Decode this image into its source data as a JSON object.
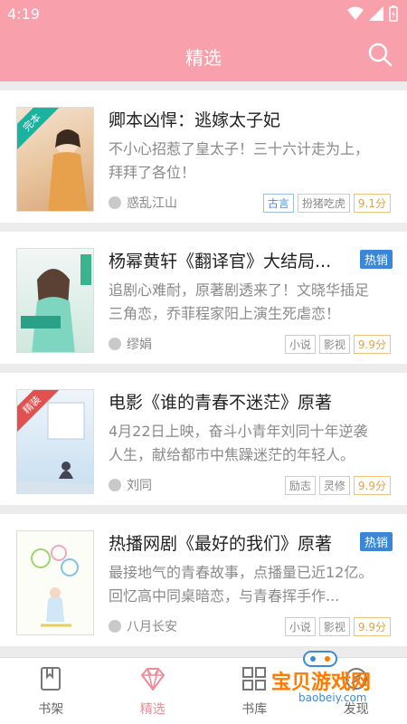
{
  "status": {
    "time": "4:19"
  },
  "header": {
    "title": "精选"
  },
  "books": [
    {
      "title": "卿本凶悍：逃嫁太子妃",
      "desc": "不小心招惹了皇太子！三十六计走为上，拜拜了各位！",
      "author": "惑乱江山",
      "tags": [
        "古言",
        "扮猪吃虎"
      ],
      "score": "9.1分",
      "hot": "",
      "ribbon": "完本",
      "ribbonColor": "#19b3a0"
    },
    {
      "title": "杨幂黄轩《翻译官》大结局...",
      "desc": "追剧心难耐，原著剧透来了！文晓华插足三角恋，乔菲程家阳上演生死虐恋！",
      "author": "缪娟",
      "tags": [
        "小说",
        "影视"
      ],
      "score": "9.9分",
      "hot": "热销",
      "ribbon": "",
      "ribbonColor": ""
    },
    {
      "title": "电影《谁的青春不迷茫》原著",
      "desc": "4月22日上映，奋斗小青年刘同十年逆袭人生，献给都市中焦躁迷茫的年轻人。",
      "author": "刘同",
      "tags": [
        "励志",
        "灵修"
      ],
      "score": "9.9分",
      "hot": "",
      "ribbon": "精装",
      "ribbonColor": "#e35050"
    },
    {
      "title": "热播网剧《最好的我们》原著",
      "desc": "最接地气的青春故事，点播量已近12亿。回忆高中同桌暗恋，与青春挥手作...",
      "author": "八月长安",
      "tags": [
        "小说",
        "影视"
      ],
      "score": "9.9分",
      "hot": "热销",
      "ribbon": "",
      "ribbonColor": ""
    }
  ],
  "nav": [
    {
      "label": "书架",
      "icon": "bookshelf-icon"
    },
    {
      "label": "精选",
      "icon": "diamond-icon"
    },
    {
      "label": "书库",
      "icon": "library-icon"
    },
    {
      "label": "发现",
      "icon": "discover-icon"
    }
  ],
  "watermark": {
    "text": "宝贝游戏网",
    "url": "baobeiy.com"
  },
  "colors": {
    "accent": "#f8a0ab",
    "hot": "#3a87d8",
    "score": "#e8a238"
  }
}
